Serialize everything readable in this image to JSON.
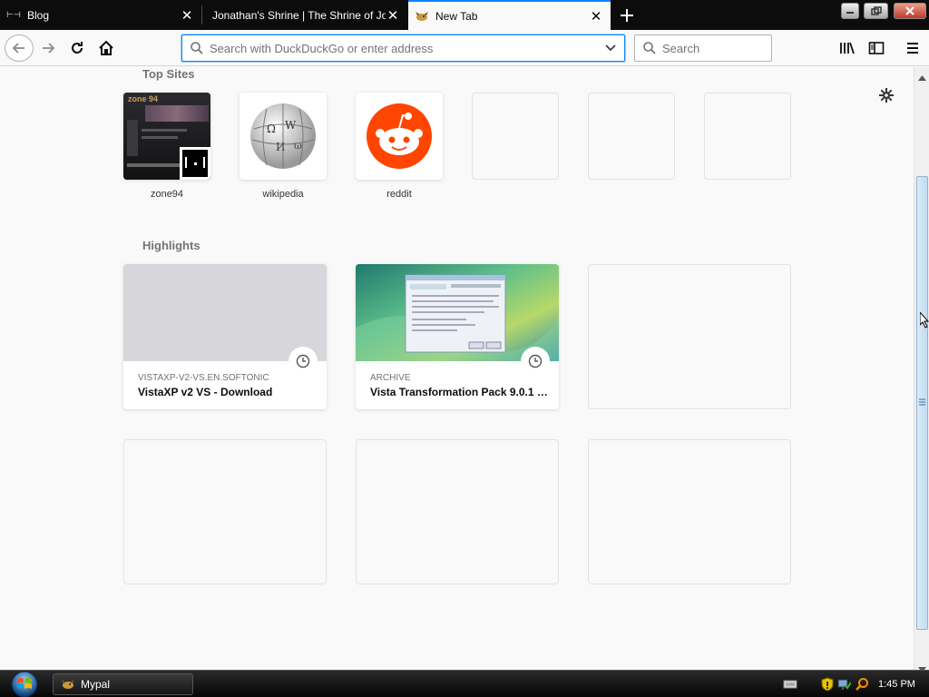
{
  "tabs": [
    {
      "title": "Blog",
      "icon": "bracket-favicon"
    },
    {
      "title": "Jonathan's Shrine | The Shrine of Jona",
      "icon": "none"
    },
    {
      "title": "New Tab",
      "icon": "mypal-favicon",
      "selected": true
    }
  ],
  "toolbar": {
    "url_placeholder": "Search with DuckDuckGo or enter address",
    "search_placeholder": "Search"
  },
  "top_sites": {
    "title": "Top Sites",
    "tiles": [
      {
        "label": "zone94"
      },
      {
        "label": "wikipedia"
      },
      {
        "label": "reddit"
      }
    ]
  },
  "highlights": {
    "title": "Highlights",
    "cards": [
      {
        "context": "VISTAXP-V2-VS.EN.SOFTONIC",
        "title": "VistaXP v2 VS - Download"
      },
      {
        "context": "ARCHIVE",
        "title": "Vista Transformation Pack 9.0.1 :..."
      }
    ]
  },
  "taskbar": {
    "app_label": "Mypal",
    "time": "1:45 PM"
  },
  "colors": {
    "accent": "#0a84ff",
    "reddit": "#ff4500",
    "tabbar": "#0c0c0d"
  }
}
